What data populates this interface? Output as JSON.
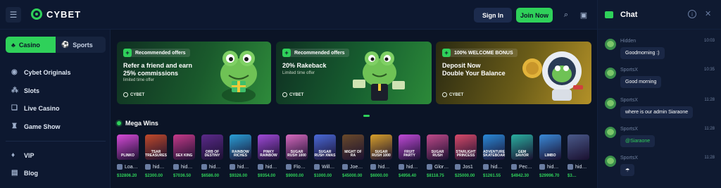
{
  "brand": {
    "name": "CYBET"
  },
  "header": {
    "signin_label": "Sign In",
    "join_label": "Join Now"
  },
  "sidebar": {
    "tabs": [
      {
        "label": "Casino",
        "active": true
      },
      {
        "label": "Sports",
        "active": false
      }
    ],
    "items": [
      {
        "label": "Cybet Originals",
        "icon": "originals-icon"
      },
      {
        "label": "Slots",
        "icon": "slots-icon"
      },
      {
        "label": "Live Casino",
        "icon": "live-casino-icon"
      },
      {
        "label": "Game Show",
        "icon": "game-show-icon"
      },
      {
        "label": "VIP",
        "icon": "vip-icon"
      },
      {
        "label": "Blog",
        "icon": "blog-icon"
      }
    ]
  },
  "banners": [
    {
      "tag": "Recommended offers",
      "title_line1": "Refer a friend and earn",
      "title_line2": "25% commissions",
      "subtitle": "limited time offer",
      "brand": "CYBET"
    },
    {
      "tag": "Recommended offers",
      "title_line1": "20% Rakeback",
      "title_line2": "",
      "subtitle": "Limited time offer",
      "brand": "CYBET"
    },
    {
      "tag": "100% WELCOME BONUS",
      "title_line1": "Deposit Now",
      "title_line2": "Double Your Balance",
      "subtitle": "",
      "brand": "CYBET"
    }
  ],
  "mega_wins": {
    "title": "Mega Wins",
    "items": [
      {
        "game": "PLINKO",
        "user": "Loa…",
        "amount": "$32806.20"
      },
      {
        "game": "TSAR TREASURES",
        "user": "hid…",
        "amount": "$2300.00"
      },
      {
        "game": "SEX KING",
        "user": "hid…",
        "amount": "$7036.50"
      },
      {
        "game": "ORB OF DESTINY",
        "user": "hid…",
        "amount": "$6586.00"
      },
      {
        "game": "RAINBOW RICHES",
        "user": "hid…",
        "amount": "$9326.00"
      },
      {
        "game": "PINKY RAINBOW",
        "user": "hid…",
        "amount": "$9354.00"
      },
      {
        "game": "SUGAR RUSH 1000",
        "user": "Flo…",
        "amount": "$9000.00"
      },
      {
        "game": "SUGAR RUSH XMAS",
        "user": "Will…",
        "amount": "$1000.00"
      },
      {
        "game": "MIGHT OF RA",
        "user": "Joe…",
        "amount": "$45000.00"
      },
      {
        "game": "SUGAR RUSH 1000",
        "user": "hid…",
        "amount": "$6000.00"
      },
      {
        "game": "FRUIT PARTY",
        "user": "hid…",
        "amount": "$4956.40"
      },
      {
        "game": "SUGAR RUSH",
        "user": "Glor…",
        "amount": "$8118.75"
      },
      {
        "game": "STARLIGHT PRINCESS",
        "user": "Jos1",
        "amount": "$25000.00"
      },
      {
        "game": "ADVENTURE SKATEBOARD",
        "user": "hid…",
        "amount": "$1261.55"
      },
      {
        "game": "GEM SAVIOR",
        "user": "Pec…",
        "amount": "$4942.30"
      },
      {
        "game": "LIMBO",
        "user": "hid…",
        "amount": "$29996.70"
      },
      {
        "game": "",
        "user": "hid…",
        "amount": "$3…"
      }
    ]
  },
  "chat": {
    "title": "Chat",
    "messages": [
      {
        "user": "Hidden",
        "time": "10:03",
        "text": "Goodmorning :)"
      },
      {
        "user": "SportsX",
        "time": "10:35",
        "text": "Good morning"
      },
      {
        "user": "SportsX",
        "time": "11:28",
        "text": "where is our admin Siaraone"
      },
      {
        "user": "SportsX",
        "time": "11:28",
        "text": "@Siaraone"
      },
      {
        "user": "SportsX",
        "time": "11:28",
        "text": "☂"
      }
    ]
  },
  "colors": {
    "accent": "#2fd15a",
    "background": "#0b1426",
    "panel": "#0d1830"
  }
}
